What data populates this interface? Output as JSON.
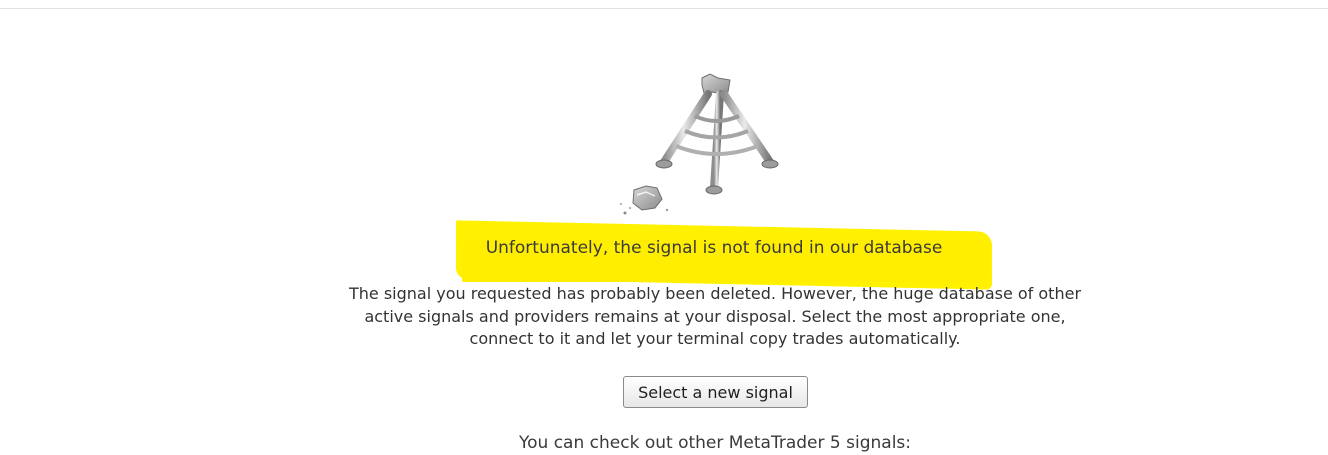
{
  "error": {
    "headline": "Unfortunately, the signal is not found in our database",
    "description": "The signal you requested has probably been deleted. However, the huge database of other active signals and providers remains at your disposal. Select the most appropriate one, connect to it and let your terminal copy trades automatically.",
    "illustration_icon": "broken-antenna-icon"
  },
  "actions": {
    "select_signal_label": "Select a new signal"
  },
  "footer": {
    "more_text": "You can check out other MetaTrader 5 signals:"
  },
  "colors": {
    "highlight": "#fff100",
    "text": "#333333",
    "divider": "#e2e2e2"
  }
}
